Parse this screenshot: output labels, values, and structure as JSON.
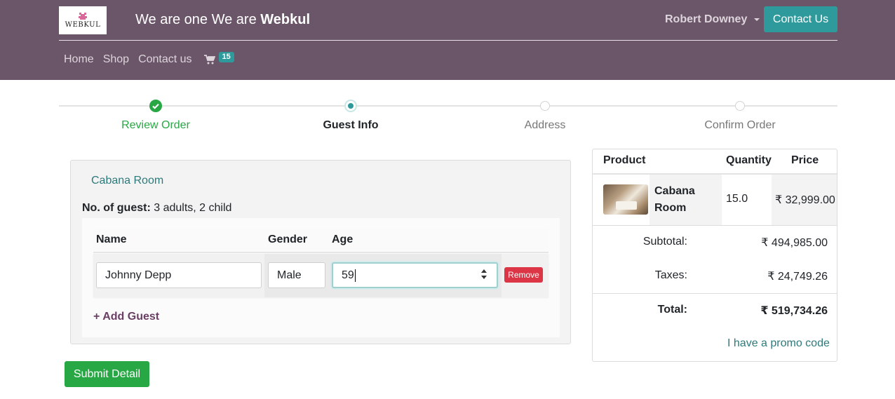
{
  "header": {
    "logo_text": "WEBKUL",
    "tagline_prefix": "We are one We are ",
    "tagline_brand": "Webkul",
    "user_name": "Robert Downey",
    "contact_button": "Contact Us",
    "nav": [
      "Home",
      "Shop",
      "Contact us"
    ],
    "cart_count": "15"
  },
  "steps": [
    {
      "label": "Review Order",
      "state": "done"
    },
    {
      "label": "Guest Info",
      "state": "active"
    },
    {
      "label": "Address",
      "state": "pending"
    },
    {
      "label": "Confirm Order",
      "state": "pending"
    }
  ],
  "guest_form": {
    "room_title": "Cabana Room",
    "guest_count_label": "No. of guest:",
    "guest_count_value": "3 adults, 2 child",
    "columns": [
      "Name",
      "Gender",
      "Age"
    ],
    "guest": {
      "name": "Johnny Depp",
      "gender": "Male",
      "age": "59"
    },
    "remove_label": "Remove",
    "add_guest_label": "+ Add Guest"
  },
  "submit_label": "Submit Detail",
  "summary": {
    "columns": [
      "Product",
      "Quantity",
      "Price"
    ],
    "product": {
      "name": "Cabana Room",
      "quantity": "15.0",
      "price": "₹ 32,999.00"
    },
    "subtotal_label": "Subtotal:",
    "subtotal_value": "₹ 494,985.00",
    "taxes_label": "Taxes:",
    "taxes_value": "₹ 24,749.26",
    "total_label": "Total:",
    "total_value": "₹ 519,734.26",
    "promo_label": "I have a promo code"
  },
  "colors": {
    "header_bg": "#6b5669",
    "teal": "#2f9a9c",
    "success": "#28a745",
    "danger": "#dc3545"
  }
}
